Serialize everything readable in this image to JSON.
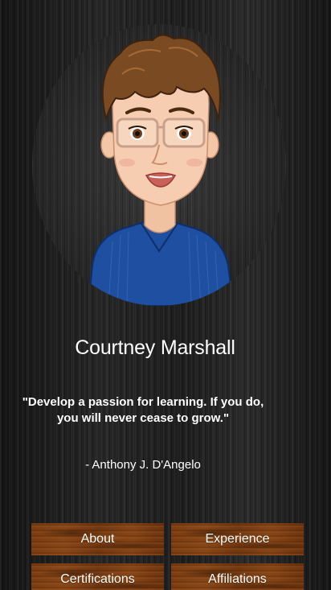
{
  "profile": {
    "name": "Courtney Marshall",
    "avatar_icon": "cartoon-avatar"
  },
  "quote": {
    "text": "\"Develop a passion for learning. If you do, you will never cease to grow.\"",
    "author": "- Anthony J. D'Angelo"
  },
  "nav": {
    "about": "About",
    "experience": "Experience",
    "certifications": "Certifications",
    "affiliations": "Affiliations"
  },
  "colors": {
    "background": "#1c1c1c",
    "button_wood": "#7a3d12",
    "text": "#ffffff",
    "shirt": "#1f4fa0",
    "hair": "#7a4a22"
  }
}
